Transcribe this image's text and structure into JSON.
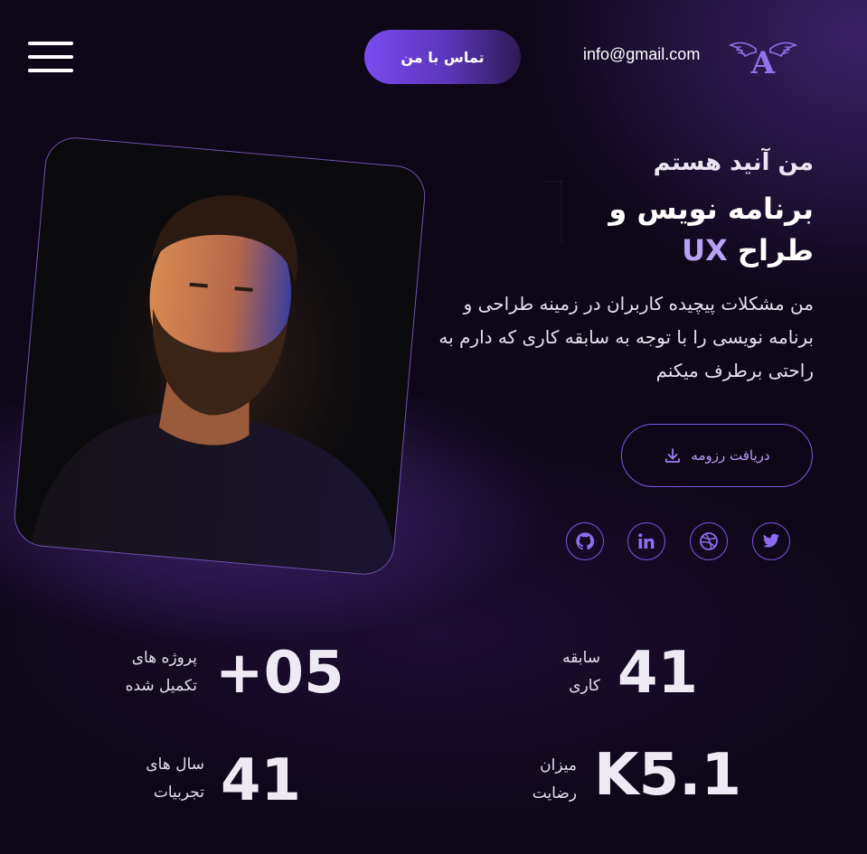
{
  "header": {
    "email": "info@gmail.com",
    "contact_label": "تماس با من",
    "logo_letter": "A"
  },
  "hero": {
    "greeting": "من آنید هستم",
    "headline_line1": "برنامه نویس و",
    "headline_line2_prefix": "طراح",
    "headline_line2_accent": "UX",
    "description": "من مشکلات پیچیده کاربران در زمینه طراحی و برنامه نویسی را با توجه به سابقه کاری که دارم به راحتی برطرف میکنم",
    "resume_label": "دریافت رزومه"
  },
  "social": [
    {
      "name": "twitter"
    },
    {
      "name": "dribbble"
    },
    {
      "name": "linkedin"
    },
    {
      "name": "github"
    }
  ],
  "stats": {
    "work_experience": {
      "value": "41",
      "label_line1": "سابقه",
      "label_line2": "کاری"
    },
    "projects": {
      "value": "+05",
      "label_line1": "پروژه های",
      "label_line2": "تکمیل شده"
    },
    "satisfaction": {
      "value": "K5.1",
      "label_line1": "میزان",
      "label_line2": "رضایت"
    },
    "years": {
      "value": "41",
      "label_line1": "سال های",
      "label_line2": "تجربیات"
    }
  },
  "colors": {
    "background": "#0e0718",
    "accent": "#7e55e6",
    "accent_light": "#b8a2f5"
  }
}
